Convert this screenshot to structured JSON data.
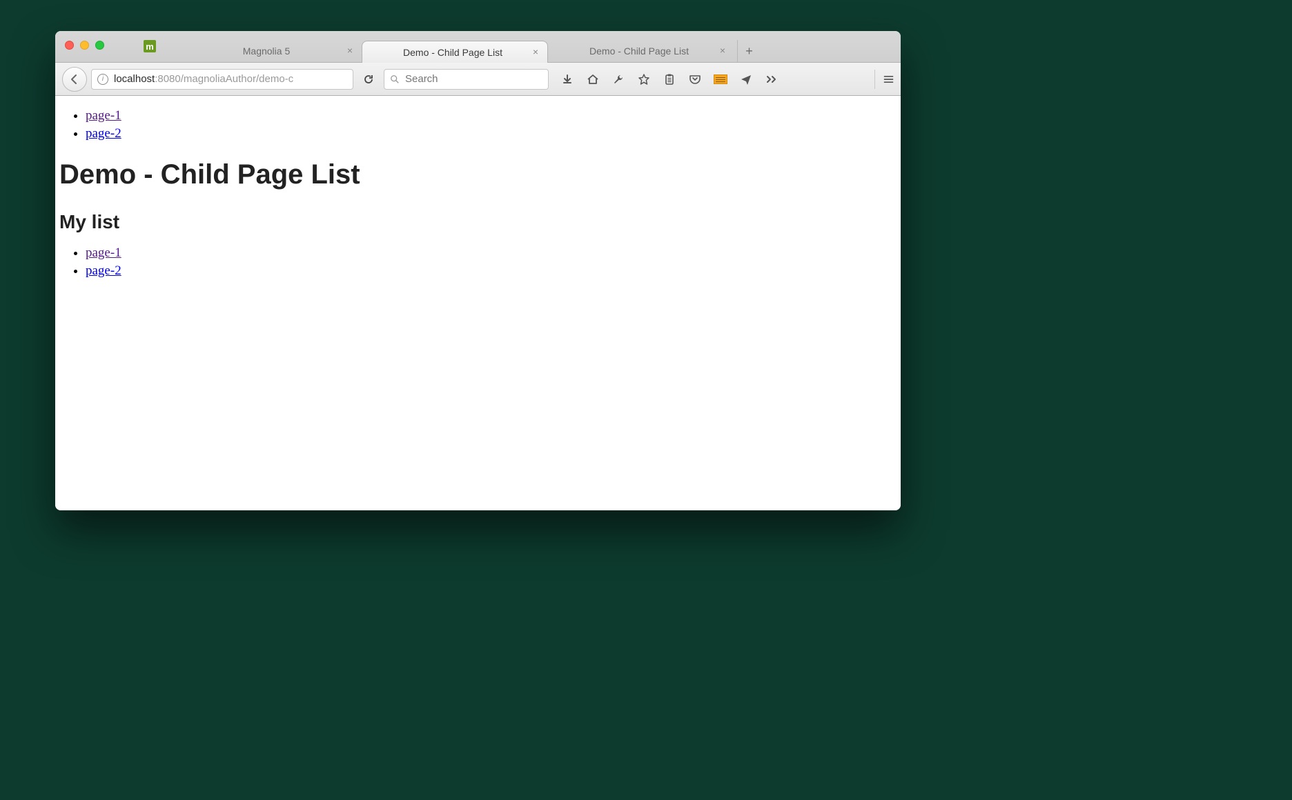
{
  "tabs": [
    {
      "title": "Magnolia 5",
      "active": false
    },
    {
      "title": "Demo - Child Page List",
      "active": true
    },
    {
      "title": "Demo - Child Page List",
      "active": false
    }
  ],
  "url": {
    "host": "localhost",
    "rest": ":8080/magnoliaAuthor/demo-c"
  },
  "search": {
    "placeholder": "Search"
  },
  "page": {
    "nav": [
      {
        "label": "page-1",
        "visited": true
      },
      {
        "label": "page-2",
        "visited": false
      }
    ],
    "h1": "Demo - Child Page List",
    "h2": "My list",
    "list": [
      {
        "label": "page-1",
        "visited": true
      },
      {
        "label": "page-2",
        "visited": false
      }
    ]
  }
}
